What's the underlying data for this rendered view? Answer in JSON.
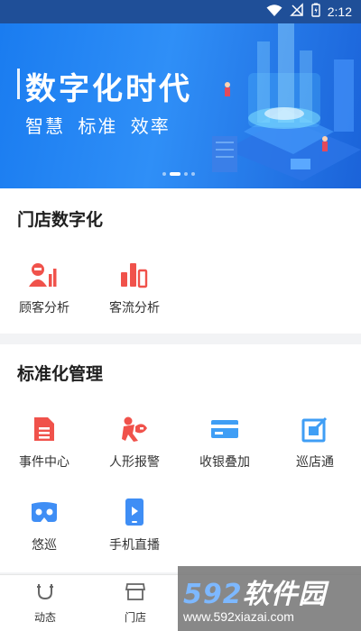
{
  "status_bar": {
    "time": "2:12"
  },
  "banner": {
    "title": "数字化时代",
    "subtitle": "智慧  标准  效率",
    "page_count": 4,
    "active_page": 2
  },
  "section_digital": {
    "title": "门店数字化",
    "items": [
      {
        "label": "顾客分析",
        "icon": "customer-analysis-icon"
      },
      {
        "label": "客流分析",
        "icon": "traffic-analysis-icon"
      }
    ]
  },
  "section_standard": {
    "title": "标准化管理",
    "items": [
      {
        "label": "事件中心",
        "icon": "event-center-icon"
      },
      {
        "label": "人形报警",
        "icon": "human-alarm-icon"
      },
      {
        "label": "收银叠加",
        "icon": "cashier-overlay-icon"
      },
      {
        "label": "巡店通",
        "icon": "store-patrol-icon"
      },
      {
        "label": "悠巡",
        "icon": "vr-patrol-icon"
      },
      {
        "label": "手机直播",
        "icon": "mobile-live-icon"
      }
    ]
  },
  "bottom_nav": {
    "items": [
      {
        "label": "动态",
        "icon": "magnet-icon"
      },
      {
        "label": "门店",
        "icon": "store-icon"
      }
    ]
  },
  "watermark": {
    "brand_num": "592",
    "brand_text": "软件园",
    "url": "www.592xiazai.com"
  },
  "colors": {
    "accent_red": "#f0524b",
    "accent_blue": "#3f8ef5",
    "banner_blue": "#1a7cf0"
  }
}
